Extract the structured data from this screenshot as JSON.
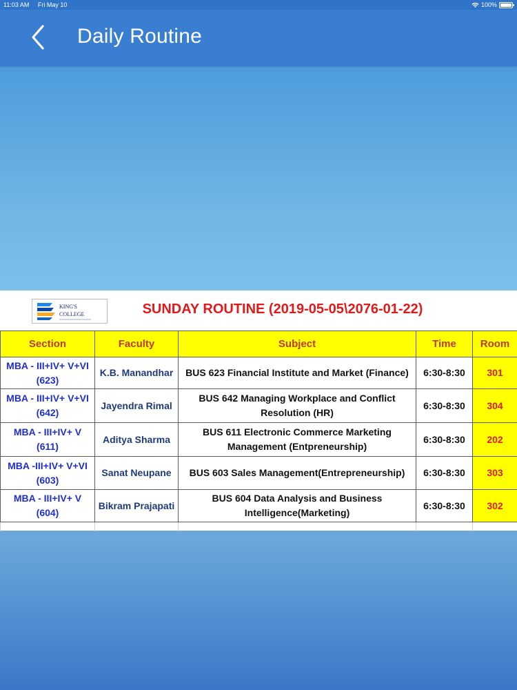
{
  "status": {
    "time": "11:03 AM",
    "date": "Fri May 10",
    "battery": "100%",
    "battery_level": 1.0
  },
  "nav": {
    "title": "Daily Routine",
    "back_icon": "chevron-left-icon"
  },
  "routine": {
    "title": "SUNDAY ROUTINE (2019-05-05\\2076-01-22)",
    "logo": {
      "name": "KING'S COLLEGE",
      "tagline": "Any Brand. Change Everyone"
    },
    "columns": [
      "Section",
      "Faculty",
      "Subject",
      "Time",
      "Room"
    ],
    "rows": [
      {
        "section": [
          "MBA - III+IV+ V+VI",
          "(623)"
        ],
        "faculty": "K.B. Manandhar",
        "subject": [
          "BUS 623 Financial Institute and Market (Finance)"
        ],
        "time": "6:30-8:30",
        "room": "301"
      },
      {
        "section": [
          "MBA - III+IV+ V+VI",
          "(642)"
        ],
        "faculty": "Jayendra Rimal",
        "subject": [
          "BUS 642 Managing Workplace and Conflict",
          "Resolution (HR)"
        ],
        "time": "6:30-8:30",
        "room": "304"
      },
      {
        "section": [
          "MBA - III+IV+ V",
          "(611)"
        ],
        "faculty": "Aditya Sharma",
        "subject": [
          "BUS 611 Electronic Commerce Marketing",
          "Management (Entpreneurship)"
        ],
        "time": "6:30-8:30",
        "room": "202"
      },
      {
        "section": [
          "MBA -III+IV+ V+VI",
          "(603)"
        ],
        "faculty": "Sanat Neupane",
        "subject": [
          "BUS 603 Sales Management(Entrepreneurship)"
        ],
        "time": "6:30-8:30",
        "room": "303"
      },
      {
        "section": [
          "MBA - III+IV+ V",
          "(604)"
        ],
        "faculty": "Bikram Prajapati",
        "subject": [
          "BUS 604 Data Analysis and Business",
          "Intelligence(Marketing)"
        ],
        "time": "6:30-8:30",
        "room": "302"
      }
    ]
  },
  "colors": {
    "nav_bar": "#3a7ed1",
    "header_fill": "#ffff00",
    "title_red": "#e01a1a",
    "section_blue": "#1f2fcc"
  }
}
